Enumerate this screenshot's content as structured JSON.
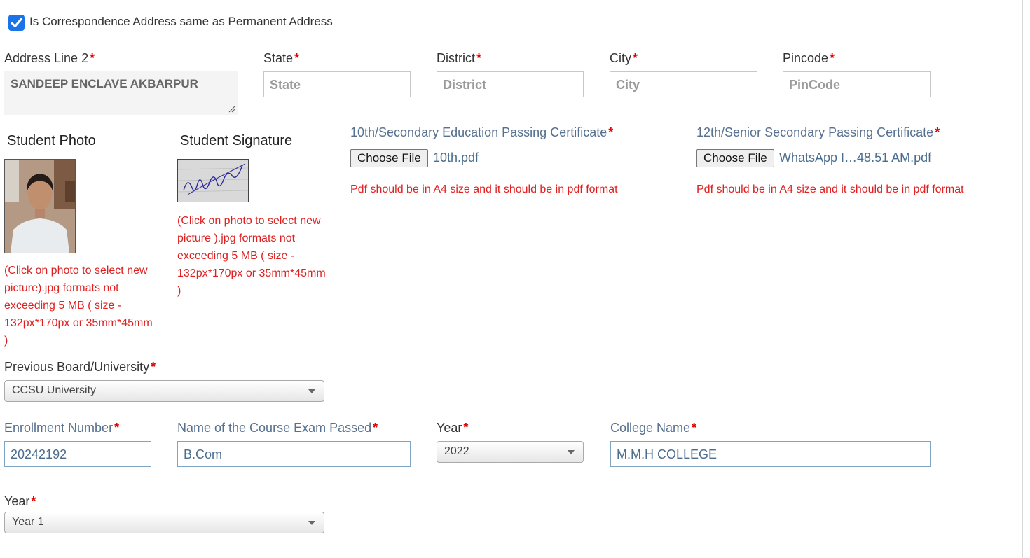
{
  "correspondence": {
    "checkbox_label": "Is Correspondence Address same as Permanent Address",
    "checked": true
  },
  "address": {
    "line2_label": "Address Line 2",
    "line2_value": "SANDEEP ENCLAVE AKBARPUR",
    "state_label": "State",
    "state_placeholder": "State",
    "district_label": "District",
    "district_placeholder": "District",
    "city_label": "City",
    "city_placeholder": "City",
    "pincode_label": "Pincode",
    "pincode_placeholder": "PinCode"
  },
  "required_mark": "*",
  "photo": {
    "heading": "Student Photo",
    "note": "(Click on photo to select new picture).jpg formats not exceeding 5 MB ( size - 132px*170px or 35mm*45mm )"
  },
  "signature": {
    "heading": "Student Signature",
    "note": "(Click on photo to select new picture ).jpg formats not exceeding 5 MB ( size - 132px*170px or 35mm*45mm )"
  },
  "cert10": {
    "label": "10th/Secondary Education Passing Certificate",
    "button": "Choose File",
    "file": "10th.pdf",
    "note": "Pdf should be in A4 size and it should be in pdf format"
  },
  "cert12": {
    "label": "12th/Senior Secondary Passing Certificate",
    "button": "Choose File",
    "file": "WhatsApp I…48.51 AM.pdf",
    "note": "Pdf should be in A4 size and it should be in pdf format"
  },
  "board": {
    "label": "Previous Board/University",
    "value": "CCSU University"
  },
  "enrollment": {
    "label": "Enrollment Number",
    "value": "20242192"
  },
  "course": {
    "label": "Name of the Course Exam Passed",
    "value": "B.Com"
  },
  "year_passed": {
    "label": "Year",
    "value": "2022"
  },
  "college": {
    "label": "College Name",
    "value": "M.M.H COLLEGE"
  },
  "year": {
    "label": "Year",
    "value": "Year 1"
  },
  "colors": {
    "required": "#e00000",
    "note": "#e02020",
    "checkbox": "#1a73e8",
    "blue_label": "#56708f"
  }
}
